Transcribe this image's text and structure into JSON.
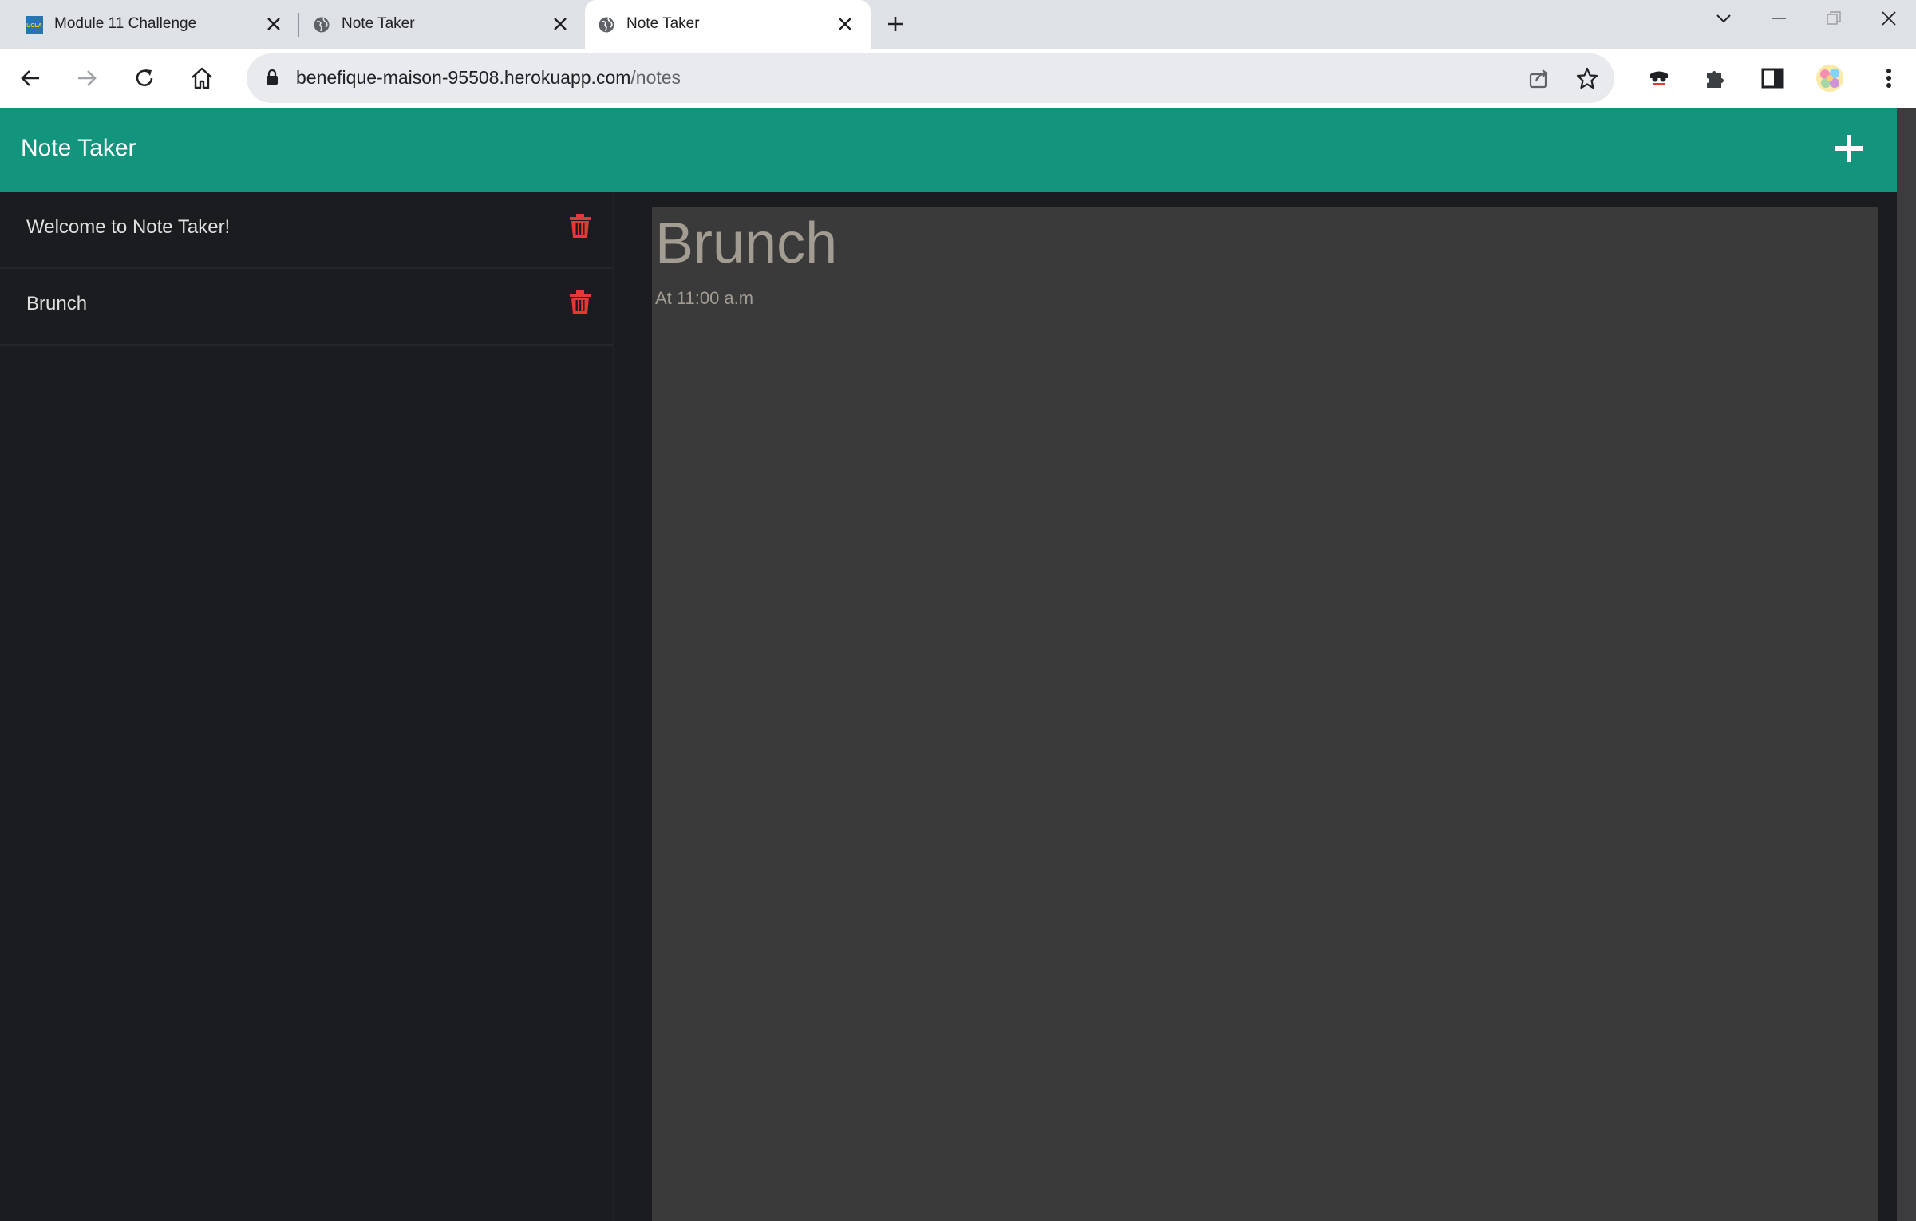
{
  "browser": {
    "tabs": [
      {
        "title": "Module 11 Challenge",
        "favicon": "ucla-logo-icon",
        "favicon_text": "UCLA",
        "active": false
      },
      {
        "title": "Note Taker",
        "favicon": "globe-icon",
        "active": false
      },
      {
        "title": "Note Taker",
        "favicon": "globe-icon",
        "active": true
      }
    ],
    "address": {
      "domain": "benefique-maison-95508.herokuapp.com",
      "path": "/notes"
    }
  },
  "app": {
    "brand": "Note Taker",
    "theme_color": "#13957d",
    "delete_color": "#e53935",
    "notes": [
      {
        "title": "Welcome to Note Taker!"
      },
      {
        "title": "Brunch"
      }
    ],
    "active_note": {
      "title": "Brunch",
      "text": "At 11:00 a.m"
    }
  }
}
